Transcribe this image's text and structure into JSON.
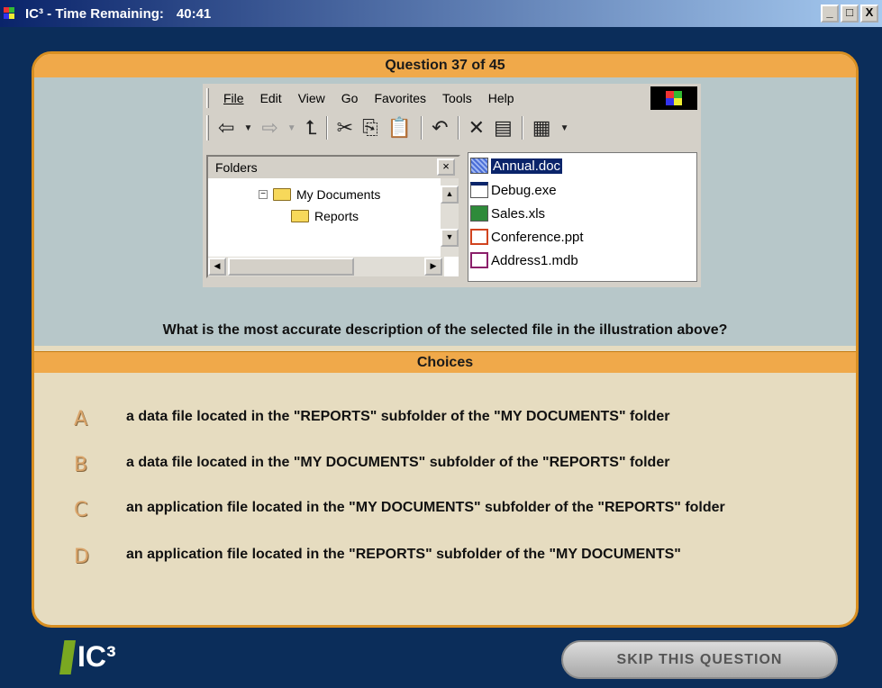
{
  "window": {
    "app_name": "IC³ - Time Remaining:",
    "time_remaining": "40:41",
    "controls": [
      "_",
      "□",
      "X"
    ]
  },
  "question": {
    "header": "Question 37 of 45",
    "text": "What is the most accurate description of the selected file in the illustration above?"
  },
  "illustration": {
    "menu": [
      "File",
      "Edit",
      "View",
      "Go",
      "Favorites",
      "Tools",
      "Help"
    ],
    "toolbar_icons": [
      "back-icon",
      "forward-icon",
      "up-folder-icon",
      "cut-icon",
      "copy-icon",
      "paste-icon",
      "undo-icon",
      "delete-icon",
      "properties-icon",
      "views-icon"
    ],
    "folders_pane": {
      "title": "Folders",
      "close": "×",
      "items": [
        "My Documents",
        "Reports"
      ]
    },
    "files": [
      {
        "name": "Annual.doc",
        "selected": true
      },
      {
        "name": "Debug.exe",
        "selected": false
      },
      {
        "name": "Sales.xls",
        "selected": false
      },
      {
        "name": "Conference.ppt",
        "selected": false
      },
      {
        "name": "Address1.mdb",
        "selected": false
      }
    ]
  },
  "choices": {
    "header": "Choices",
    "items": [
      {
        "letter": "A",
        "text": "a data file located in the \"REPORTS\" subfolder of the \"MY DOCUMENTS\" folder"
      },
      {
        "letter": "B",
        "text": "a data file located in the \"MY DOCUMENTS\" subfolder of the \"REPORTS\" folder"
      },
      {
        "letter": "C",
        "text": "an application file located in the \"MY DOCUMENTS\" subfolder of the \"REPORTS\" folder"
      },
      {
        "letter": "D",
        "text": "an application file located in the \"REPORTS\" subfolder of the \"MY DOCUMENTS\""
      }
    ]
  },
  "footer": {
    "logo_text": "IC³",
    "skip_label": "SKIP THIS QUESTION"
  },
  "colors": {
    "accent_orange": "#f0a94a",
    "panel_beige": "#e6dcc0",
    "question_bg": "#b7c7c9",
    "background_navy": "#0b2d5a"
  }
}
